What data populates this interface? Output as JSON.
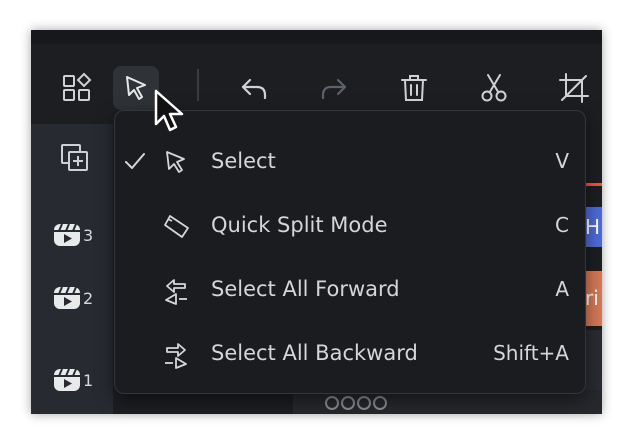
{
  "toolbar": {
    "buttons": [
      {
        "name": "layout-icon"
      },
      {
        "name": "select-tool-icon"
      },
      {
        "name": "undo-icon"
      },
      {
        "name": "redo-icon"
      },
      {
        "name": "delete-icon"
      },
      {
        "name": "scissors-icon"
      },
      {
        "name": "crop-icon"
      }
    ]
  },
  "tracks": [
    {
      "number": "3"
    },
    {
      "number": "2"
    },
    {
      "number": "1"
    }
  ],
  "timeline": {
    "clip_blue_text": "H",
    "clip_orange_text": "ri"
  },
  "menu": {
    "items": [
      {
        "label": "Select",
        "shortcut": "V",
        "checked": true,
        "icon": "pointer-icon"
      },
      {
        "label": "Quick Split Mode",
        "shortcut": "C",
        "checked": false,
        "icon": "split-tag-icon"
      },
      {
        "label": "Select All Forward",
        "shortcut": "A",
        "checked": false,
        "icon": "select-forward-icon"
      },
      {
        "label": "Select All Backward",
        "shortcut": "Shift+A",
        "checked": false,
        "icon": "select-backward-icon"
      }
    ]
  },
  "colors": {
    "accent_red": "#e05a4a",
    "clip_blue": "#4d6cd8",
    "clip_orange": "#d67a58",
    "menu_bg": "#1b1c20"
  }
}
